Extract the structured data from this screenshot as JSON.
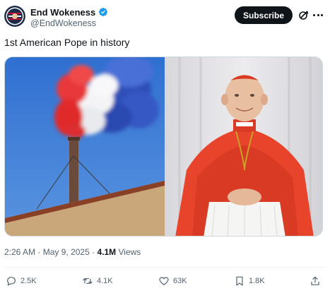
{
  "author": {
    "display_name": "End Wokeness",
    "handle": "@EndWokeness",
    "verified": true,
    "verified_color": "#1d9bf0"
  },
  "header": {
    "subscribe_label": "Subscribe",
    "grok_icon": "grok-icon",
    "more_icon": "more-icon"
  },
  "tweet": {
    "text": "1st American Pope in history",
    "time": "2:26 AM",
    "date": "May 9, 2025",
    "views_count": "4.1M",
    "views_label": "Views"
  },
  "media": [
    {
      "icon": "chimney-smoke-photo"
    },
    {
      "icon": "cardinal-portrait-photo"
    }
  ],
  "actions": {
    "replies": "2.5K",
    "reposts": "4.1K",
    "likes": "63K",
    "bookmarks": "1.8K"
  },
  "colors": {
    "text_primary": "#0f1419",
    "text_secondary": "#536471",
    "button_bg": "#0f1419"
  }
}
